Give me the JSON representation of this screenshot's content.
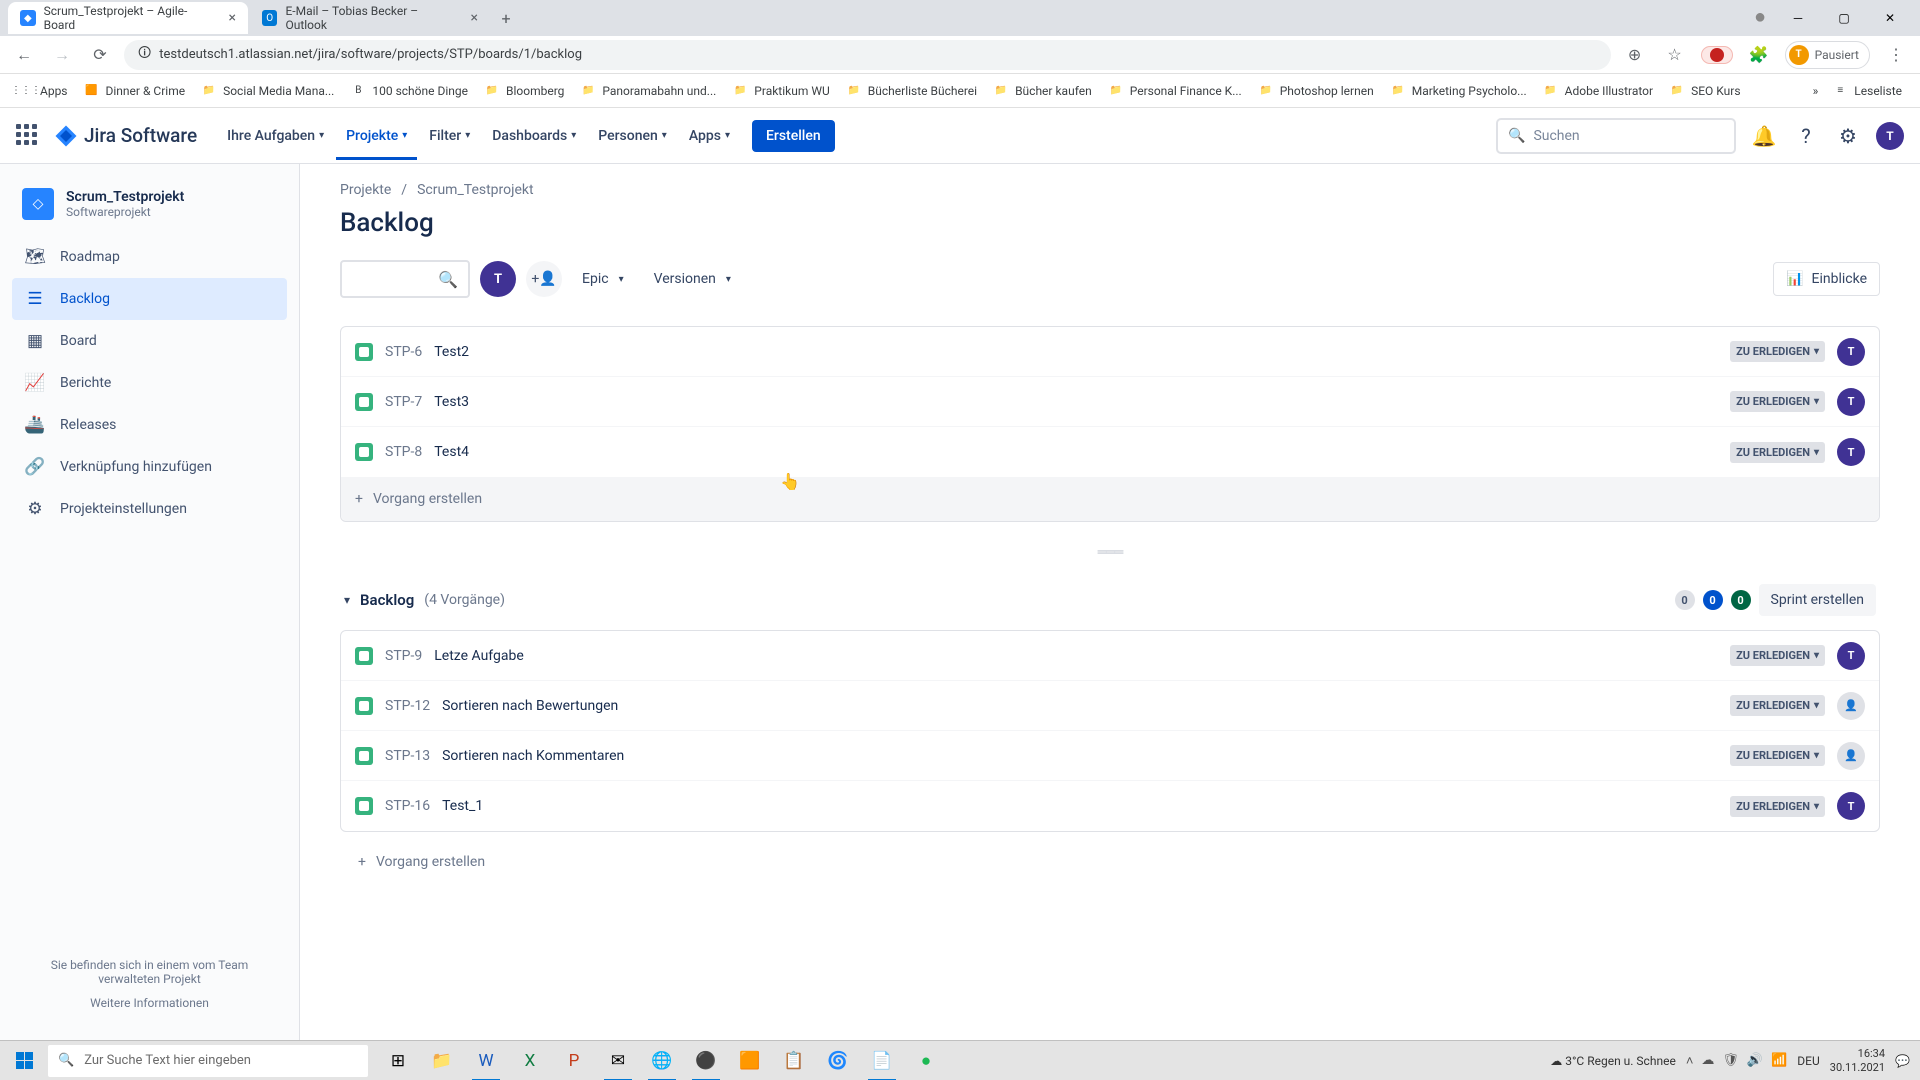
{
  "browser": {
    "tabs": [
      {
        "favicon": "🟦",
        "title": "Scrum_Testprojekt – Agile-Board"
      },
      {
        "favicon": "📧",
        "title": "E-Mail – Tobias Becker – Outlook"
      }
    ],
    "url": "testdeutsch1.atlassian.net/jira/software/projects/STP/boards/1/backlog",
    "profile_status": "Pausiert",
    "bookmarks": [
      {
        "icon": "⋮⋮⋮",
        "label": "Apps"
      },
      {
        "icon": "🟧",
        "label": "Dinner & Crime"
      },
      {
        "icon": "📁",
        "label": "Social Media Mana..."
      },
      {
        "icon": "B",
        "label": "100 schöne Dinge"
      },
      {
        "icon": "📁",
        "label": "Bloomberg"
      },
      {
        "icon": "📁",
        "label": "Panoramabahn und..."
      },
      {
        "icon": "📁",
        "label": "Praktikum WU"
      },
      {
        "icon": "📁",
        "label": "Bücherliste Bücherei"
      },
      {
        "icon": "📁",
        "label": "Bücher kaufen"
      },
      {
        "icon": "📁",
        "label": "Personal Finance K..."
      },
      {
        "icon": "📁",
        "label": "Photoshop lernen"
      },
      {
        "icon": "📁",
        "label": "Marketing Psycholo..."
      },
      {
        "icon": "📁",
        "label": "Adobe Illustrator"
      },
      {
        "icon": "📁",
        "label": "SEO Kurs"
      }
    ],
    "reading_list": "Leseliste"
  },
  "jira_header": {
    "product": "Jira Software",
    "menu": [
      "Ihre Aufgaben",
      "Projekte",
      "Filter",
      "Dashboards",
      "Personen",
      "Apps"
    ],
    "create": "Erstellen",
    "search_placeholder": "Suchen"
  },
  "sidebar": {
    "project_name": "Scrum_Testprojekt",
    "project_type": "Softwareprojekt",
    "items": [
      {
        "icon": "🗺",
        "label": "Roadmap"
      },
      {
        "icon": "☰",
        "label": "Backlog"
      },
      {
        "icon": "▦",
        "label": "Board"
      },
      {
        "icon": "📈",
        "label": "Berichte"
      },
      {
        "icon": "🚢",
        "label": "Releases"
      },
      {
        "icon": "🔗",
        "label": "Verknüpfung hinzufügen"
      },
      {
        "icon": "⚙",
        "label": "Projekteinstellungen"
      }
    ],
    "footer_text": "Sie befinden sich in einem vom Team verwalteten Projekt",
    "footer_link": "Weitere Informationen"
  },
  "main": {
    "breadcrumb": [
      "Projekte",
      "Scrum_Testprojekt"
    ],
    "title": "Backlog",
    "filters": {
      "epic": "Epic",
      "versions": "Versionen"
    },
    "insights": "Einblicke",
    "create_issue": "Vorgang erstellen",
    "status_label": "ZU ERLEDIGEN",
    "sprint_issues": [
      {
        "key": "STP-6",
        "title": "Test2",
        "assignee": "T"
      },
      {
        "key": "STP-7",
        "title": "Test3",
        "assignee": "T"
      },
      {
        "key": "STP-8",
        "title": "Test4",
        "assignee": "T"
      }
    ],
    "backlog_section": {
      "title": "Backlog",
      "count": "(4 Vorgänge)",
      "counters": [
        "0",
        "0",
        "0"
      ],
      "sprint_button": "Sprint erstellen"
    },
    "backlog_issues": [
      {
        "key": "STP-9",
        "title": "Letze Aufgabe",
        "assignee": "T"
      },
      {
        "key": "STP-12",
        "title": "Sortieren nach Bewertungen",
        "assignee": null
      },
      {
        "key": "STP-13",
        "title": "Sortieren nach Kommentaren",
        "assignee": null
      },
      {
        "key": "STP-16",
        "title": "Test_1",
        "assignee": "T"
      }
    ]
  },
  "taskbar": {
    "search_placeholder": "Zur Suche Text hier eingeben",
    "weather": "3°C  Regen u. Schnee",
    "time": "16:34",
    "date": "30.11.2021",
    "lang": "DEU"
  }
}
